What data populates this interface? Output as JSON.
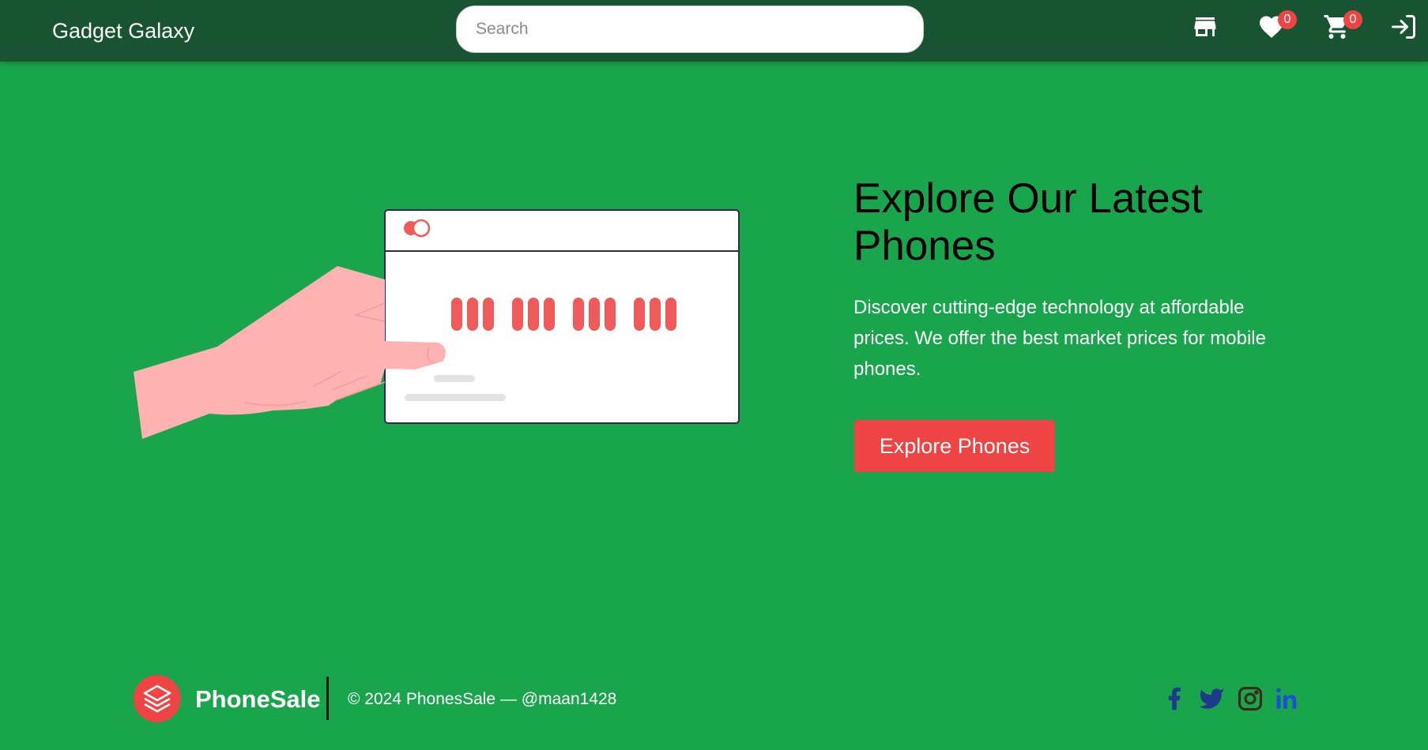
{
  "navbar": {
    "brand": "Gadget Galaxy",
    "search_placeholder": "Search",
    "icons": [
      "store-icon",
      "heart-icon",
      "cart-icon",
      "login-icon"
    ],
    "wishlist_count": "0",
    "cart_count": "0"
  },
  "hero": {
    "title": "Explore Our Latest Phones",
    "description": "Discover cutting-edge technology at affordable prices. We offer the best market prices for mobile phones.",
    "cta_label": "Explore Phones"
  },
  "footer": {
    "brand": "PhoneSale",
    "copyright": "© 2024 PhonesSale — @maan1428",
    "social": [
      "facebook-icon",
      "twitter-icon",
      "instagram-icon",
      "linkedin-icon"
    ]
  },
  "colors": {
    "nav_bg": "#185431",
    "page_bg": "#19a54b",
    "accent": "#ef4444",
    "social_icon": "#1e3a8a"
  }
}
